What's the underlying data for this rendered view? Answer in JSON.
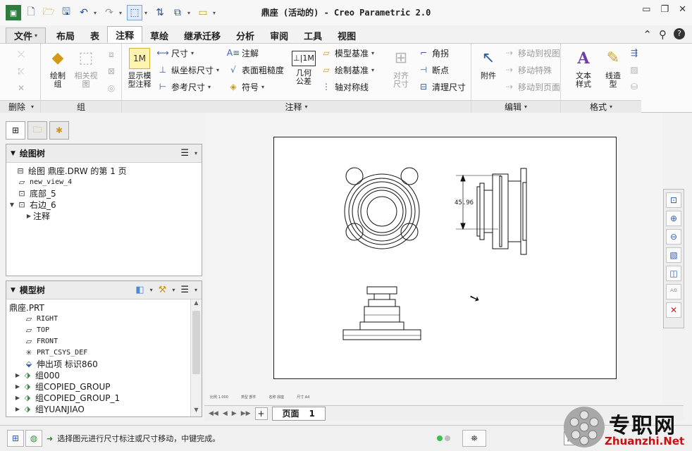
{
  "window": {
    "title": "鼎座 (活动的) - Creo Parametric 2.0"
  },
  "quick_access": [
    "new-icon",
    "open-icon",
    "save-icon",
    "undo-icon",
    "redo-icon",
    "select-box-icon",
    "regenerate-icon",
    "window-icon",
    "folder-icon"
  ],
  "tabs": [
    {
      "label": "文件",
      "dropdown": "▾"
    },
    {
      "label": "布局"
    },
    {
      "label": "表"
    },
    {
      "label": "注释"
    },
    {
      "label": "草绘"
    },
    {
      "label": "继承迁移"
    },
    {
      "label": "分析"
    },
    {
      "label": "审阅"
    },
    {
      "label": "工具"
    },
    {
      "label": "视图"
    }
  ],
  "ribbon": {
    "delete_group": {
      "footer": "删除"
    },
    "group_group": {
      "footer": "组",
      "draw_group": "绘制\n组",
      "related_view": "相关视\n图"
    },
    "annotate": {
      "footer": "注释",
      "show_model_annotations": "显示模\n型注释",
      "dimension": "尺寸",
      "ordinate_dimension": "纵坐标尺寸",
      "reference_dimension": "参考尺寸",
      "note": "注解",
      "surface_finish": "表面粗糙度",
      "symbol": "符号",
      "geometric_tolerance": "几何\n公差",
      "model_datum": "模型基准",
      "draw_datum": "绘制基准",
      "axis_symmetric": "轴对称线",
      "align_dimension": "对齐\n尺寸",
      "corner": "角拐",
      "breakpoint": "断点",
      "cleanup_dimension": "清理尺寸"
    },
    "edit": {
      "footer": "编辑",
      "attachment": "附件",
      "move_to_view": "移动到视图",
      "move_special": "移动特殊",
      "move_to_page": "移动到页面"
    },
    "format": {
      "footer": "格式",
      "text_style": "文本\n样式",
      "line_style": "线造\n型"
    }
  },
  "drawing_tree": {
    "title": "绘图树",
    "items": [
      {
        "label": "绘图 鼎座.DRW 的第 1 页",
        "icon": "sheet-icon",
        "level": 0
      },
      {
        "label": "new_view_4",
        "icon": "view-icon",
        "level": 1
      },
      {
        "label": "底部_5",
        "icon": "view-icon",
        "level": 1
      },
      {
        "label": "右边_6",
        "icon": "view-icon",
        "level": 1,
        "expanded": true
      },
      {
        "label": "注释",
        "icon": "",
        "level": 2,
        "collapsed": true
      }
    ]
  },
  "model_tree": {
    "title": "模型树",
    "items": [
      {
        "label": "鼎座.PRT",
        "level": 0
      },
      {
        "label": "RIGHT",
        "level": 1
      },
      {
        "label": "TOP",
        "level": 1
      },
      {
        "label": "FRONT",
        "level": 1
      },
      {
        "label": "PRT_CSYS_DEF",
        "level": 1
      },
      {
        "label": "伸出项 标识860",
        "level": 1
      },
      {
        "label": "组000",
        "level": 1,
        "collapsed": true
      },
      {
        "label": "组COPIED_GROUP",
        "level": 1,
        "collapsed": true
      },
      {
        "label": "组COPIED_GROUP_1",
        "level": 1,
        "collapsed": true
      },
      {
        "label": "组YUANJIAO",
        "level": 1,
        "collapsed": true
      }
    ]
  },
  "drawing": {
    "dimension_value": "45.96",
    "sheet_status": [
      "比例 1.000",
      "类型 部件",
      "名称 鼎座",
      "尺寸 A4"
    ]
  },
  "view_toolbar": [
    "zoom-fit-icon",
    "zoom-in-icon",
    "zoom-out-icon",
    "repaint-icon",
    "display-style-icon",
    "annotation-display-icon",
    "datum-display-icon"
  ],
  "page_bar": {
    "page_label": "页面",
    "page_number": "1"
  },
  "status": {
    "message": "选择图元进行尺寸标注或尺寸移动，中键完成。",
    "filter": "常"
  },
  "watermark": {
    "text": "专职网",
    "url": "Zhuanzhi.Net"
  }
}
